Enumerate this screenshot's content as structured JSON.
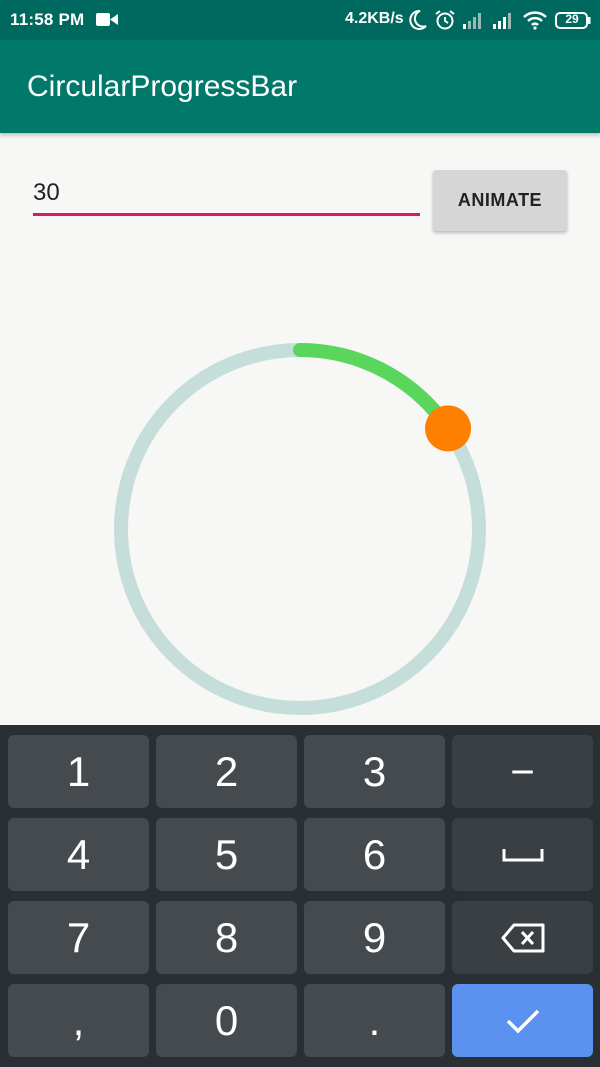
{
  "status_bar": {
    "time": "11:58 PM",
    "network_speed": "4.2KB/s",
    "battery_level": "29",
    "icons": [
      "video-icon",
      "moon-icon",
      "alarm-icon",
      "signal-icon",
      "signal-icon",
      "wifi-icon",
      "battery-icon"
    ]
  },
  "app_bar": {
    "title": "CircularProgressBar"
  },
  "form": {
    "input_value": "30",
    "animate_label": "ANIMATE"
  },
  "progress": {
    "value_fraction": 0.155,
    "track_color": "#c5ded9",
    "progress_color": "#5ad65d",
    "thumb_color": "#ff8000"
  },
  "keyboard": {
    "keys": {
      "k1": "1",
      "k2": "2",
      "k3": "3",
      "minus": "−",
      "k4": "4",
      "k5": "5",
      "k6": "6",
      "k7": "7",
      "k8": "8",
      "k9": "9",
      "comma": ",",
      "k0": "0",
      "period": "."
    },
    "icons": [
      "space-icon",
      "backspace-icon",
      "check-icon"
    ]
  },
  "colors": {
    "status_bar": "#00695f",
    "app_bar": "#00796b",
    "accent": "#d81b60",
    "done_key": "#5b92f0"
  }
}
